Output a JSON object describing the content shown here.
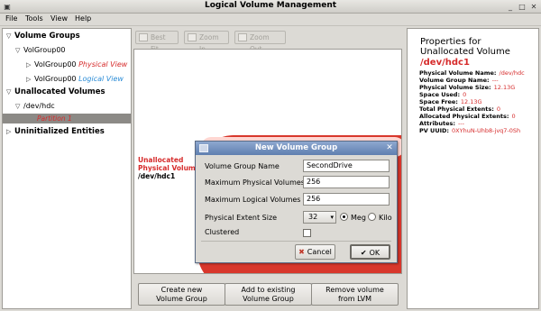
{
  "window": {
    "title": "Logical Volume Management"
  },
  "menu": {
    "file": "File",
    "tools": "Tools",
    "view": "View",
    "help": "Help"
  },
  "tree": {
    "volume_groups": "Volume Groups",
    "volgroup": "VolGroup00",
    "physical_vg": "VolGroup00",
    "physical_view": "Physical View",
    "logical_vg": "VolGroup00",
    "logical_view": "Logical View",
    "unallocated": "Unallocated Volumes",
    "dev_hdc": "/dev/hdc",
    "partition": "Partition 1",
    "uninitialized": "Uninitialized Entities"
  },
  "toolbar": {
    "best_fit": "Best Fit",
    "zoom_in": "Zoom In",
    "zoom_out": "Zoom Out"
  },
  "canvas": {
    "label_line1": "Unallocated",
    "label_line2": "Physical Volume",
    "label_dev": "/dev/hdc1"
  },
  "actions": {
    "create_l1": "Create new",
    "create_l2": "Volume Group",
    "add_l1": "Add to existing",
    "add_l2": "Volume Group",
    "remove_l1": "Remove volume",
    "remove_l2": "from LVM"
  },
  "properties": {
    "heading_l1": "Properties for",
    "heading_l2": "Unallocated Volume",
    "device": "/dev/hdc1",
    "rows": [
      {
        "label": "Physical Volume Name:",
        "value": "/dev/hdc"
      },
      {
        "label": "Volume Group Name:",
        "value": "---"
      },
      {
        "label": "Physical Volume Size:",
        "value": "12.13G"
      },
      {
        "label": "Space Used:",
        "value": "0"
      },
      {
        "label": "Space Free:",
        "value": "12.13G"
      },
      {
        "label": "Total Physical Extents:",
        "value": "0"
      },
      {
        "label": "Allocated Physical Extents:",
        "value": "0"
      },
      {
        "label": "Attributes:",
        "value": "---"
      },
      {
        "label": "PV UUID:",
        "value": "0XYhuN-Uhb8-jvq7-0Sh"
      }
    ]
  },
  "dialog": {
    "title": "New Volume Group",
    "vg_name_label": "Volume Group Name",
    "vg_name_value": "SecondDrive",
    "max_pv_label": "Maximum Physical Volumes",
    "max_pv_value": "256",
    "max_lv_label": "Maximum Logical Volumes",
    "max_lv_value": "256",
    "extent_label": "Physical Extent Size",
    "extent_value": "32",
    "unit_meg": "Meg",
    "unit_kilo": "Kilo",
    "clustered_label": "Clustered",
    "cancel": "Cancel",
    "ok": "OK"
  }
}
